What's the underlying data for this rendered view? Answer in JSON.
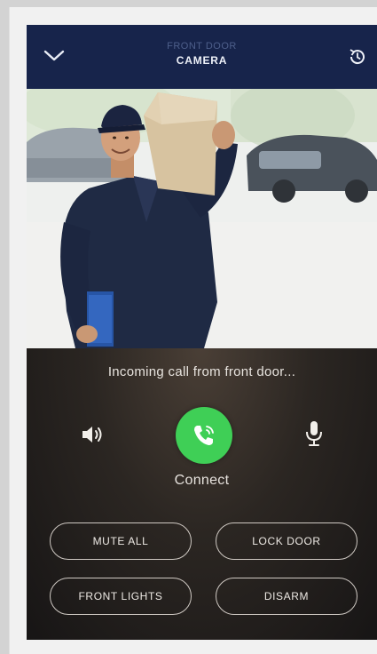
{
  "header": {
    "subtitle": "FRONT DOOR",
    "title": "CAMERA",
    "back_icon": "chevron-down-icon",
    "history_icon": "history-icon"
  },
  "call": {
    "status_text": "Incoming call from front door...",
    "speaker_icon": "speaker-icon",
    "answer_icon": "phone-icon",
    "mic_icon": "microphone-icon",
    "answer_label": "Connect",
    "answer_color": "#3fcf56"
  },
  "actions": {
    "mute_all": "MUTE ALL",
    "lock_door": "LOCK DOOR",
    "front_lights": "FRONT LIGHTS",
    "disarm": "DISARM"
  },
  "colors": {
    "header_bg": "#17244b",
    "panel_bg": "#2b2622"
  }
}
